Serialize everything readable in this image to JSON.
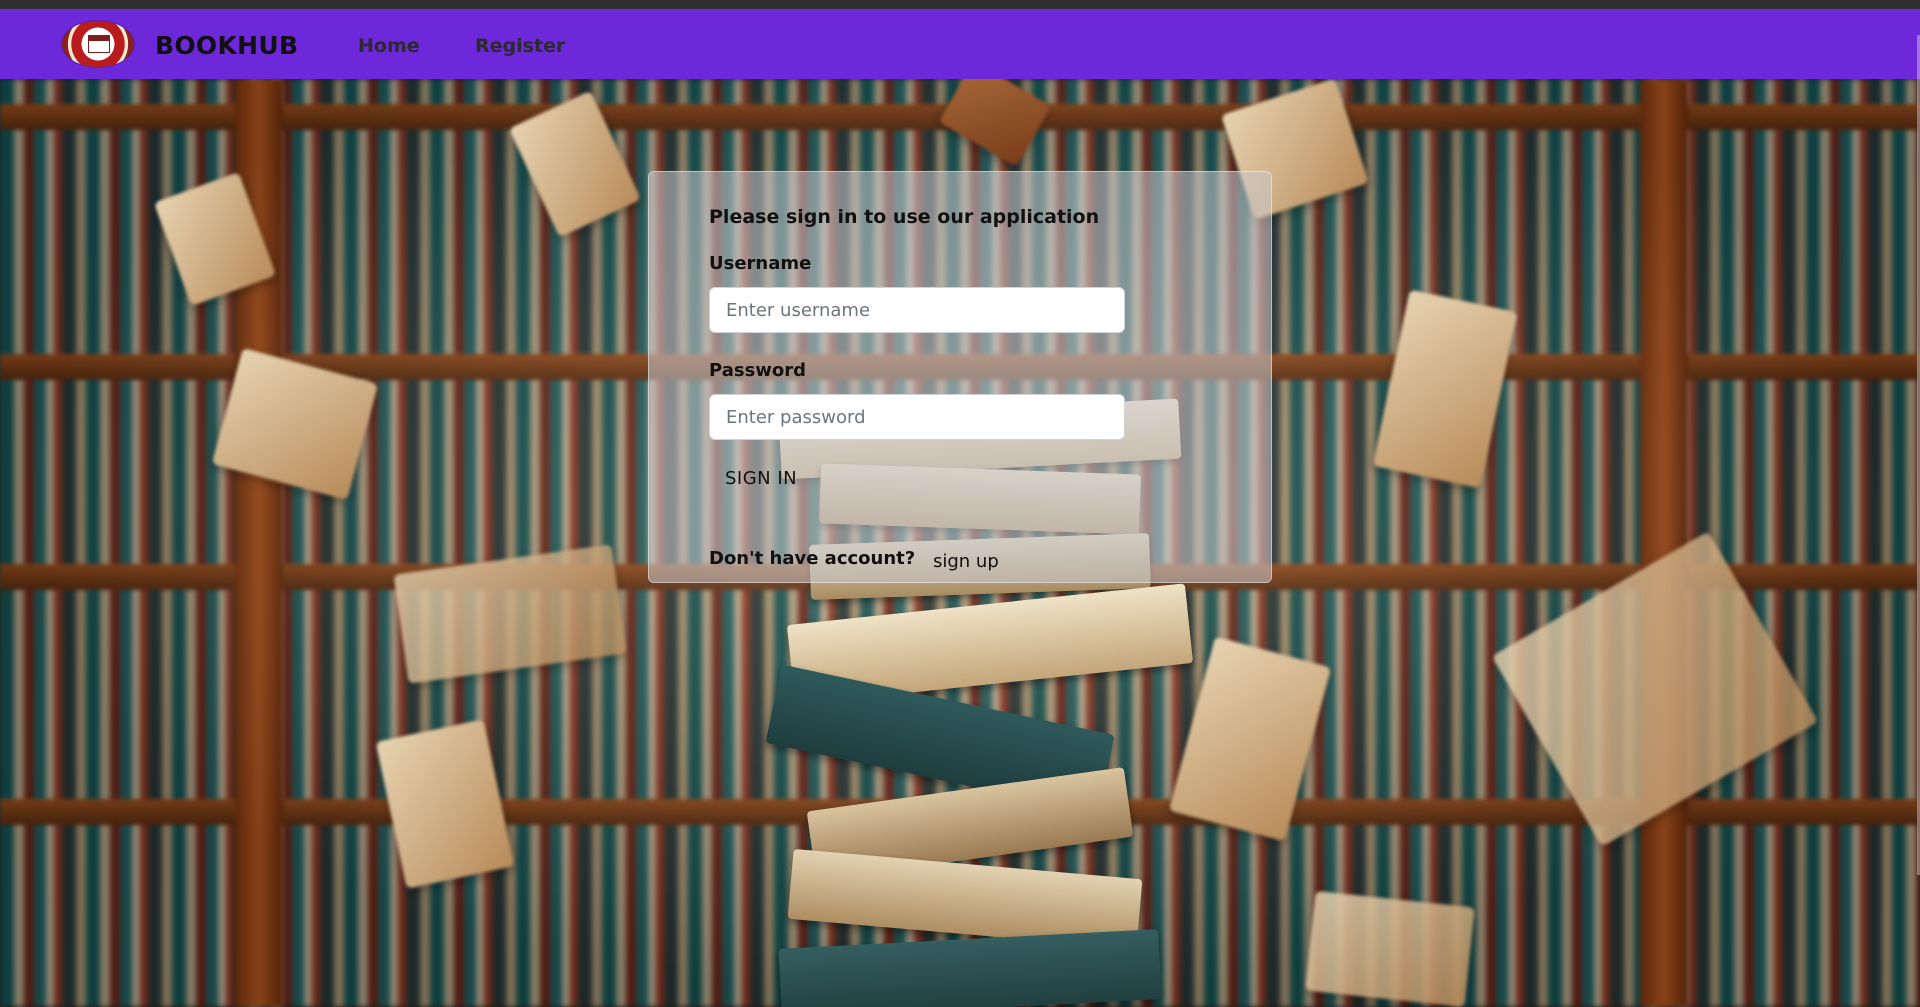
{
  "navbar": {
    "brand": "BOOKHUB",
    "links": [
      {
        "label": "Home"
      },
      {
        "label": "Register"
      }
    ],
    "background_color": "#6d28d9"
  },
  "login": {
    "title": "Please sign in to use our application",
    "username_label": "Username",
    "username_placeholder": "Enter username",
    "username_value": "",
    "password_label": "Password",
    "password_placeholder": "Enter password",
    "password_value": "",
    "signin_label": "SIGN IN",
    "no_account_text": "Don't have account?",
    "signup_label": "sign up"
  },
  "icons": {
    "logo": "university-seal-logo"
  }
}
